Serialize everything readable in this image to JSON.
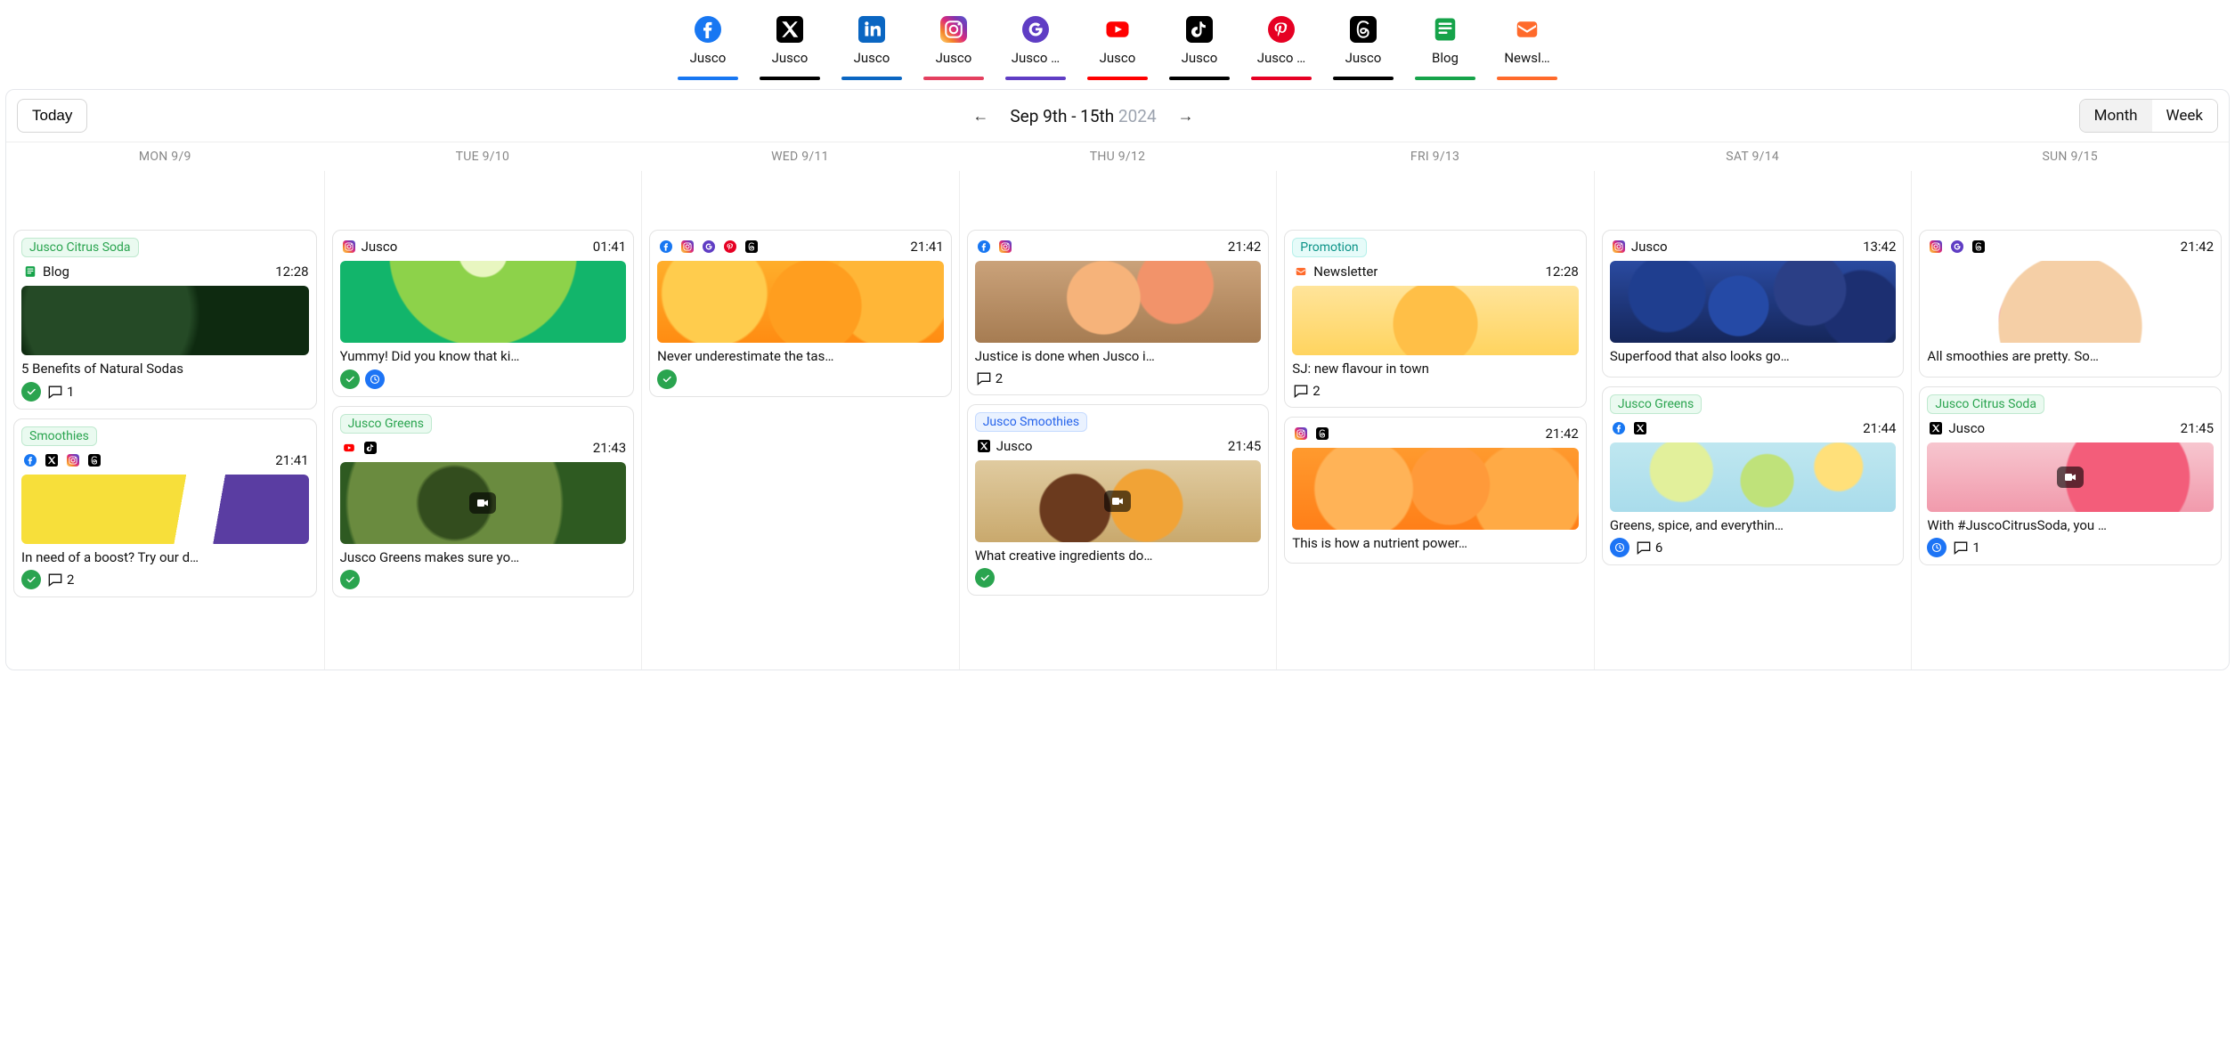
{
  "toolbar": {
    "today": "Today",
    "range_main": "Sep 9th - 15th",
    "range_year": "2024",
    "month": "Month",
    "week": "Week",
    "active_view": "Month"
  },
  "channels": [
    {
      "label": "Jusco",
      "color": "#1877F2",
      "platform": "facebook"
    },
    {
      "label": "Jusco",
      "color": "#000000",
      "platform": "x"
    },
    {
      "label": "Jusco",
      "color": "#0A66C2",
      "platform": "linkedin"
    },
    {
      "label": "Jusco",
      "color": "#E4405F",
      "platform": "instagram"
    },
    {
      "label": "Jusco …",
      "color": "#5f3dc4",
      "platform": "google"
    },
    {
      "label": "Jusco",
      "color": "#FF0000",
      "platform": "youtube"
    },
    {
      "label": "Jusco",
      "color": "#000000",
      "platform": "tiktok"
    },
    {
      "label": "Jusco …",
      "color": "#E60023",
      "platform": "pinterest"
    },
    {
      "label": "Jusco",
      "color": "#000000",
      "platform": "threads"
    },
    {
      "label": "Blog",
      "color": "#16a34a",
      "platform": "blog"
    },
    {
      "label": "Newsl…",
      "color": "#ff6a2b",
      "platform": "newsletter"
    }
  ],
  "days": [
    {
      "head": "MON 9/9"
    },
    {
      "head": "TUE 9/10"
    },
    {
      "head": "WED 9/11"
    },
    {
      "head": "THU 9/12"
    },
    {
      "head": "FRI 9/13"
    },
    {
      "head": "SAT 9/14"
    },
    {
      "head": "SUN 9/15"
    }
  ],
  "cards": {
    "mon1": {
      "tag": "Jusco Citrus Soda",
      "tag_style": "tag-green",
      "account": "Blog",
      "platforms": [
        "blog"
      ],
      "time": "12:28",
      "title": "5 Benefits of Natural Sodas",
      "thumb": "img-leaves",
      "status": [
        "approved"
      ],
      "comments": "1"
    },
    "mon2": {
      "tag": "Smoothies",
      "tag_style": "tag-green",
      "platforms": [
        "facebook",
        "x",
        "instagram",
        "threads"
      ],
      "time": "21:41",
      "title": "In need of a boost? Try our d…",
      "thumb": "img-yellow",
      "status": [
        "approved"
      ],
      "comments": "2"
    },
    "tue1": {
      "account": "Jusco",
      "platforms": [
        "instagram"
      ],
      "time": "01:41",
      "title": "Yummy! Did you know that ki…",
      "thumb": "img-kiwi",
      "thumb_tall": true,
      "status": [
        "approved",
        "scheduled"
      ]
    },
    "tue2": {
      "tag": "Jusco Greens",
      "tag_style": "tag-green",
      "platforms": [
        "youtube",
        "tiktok"
      ],
      "time": "21:43",
      "title": "Jusco Greens makes sure yo…",
      "thumb": "img-avocado",
      "thumb_tall": true,
      "video": true,
      "status": [
        "approved"
      ]
    },
    "wed1": {
      "platforms": [
        "facebook",
        "instagram",
        "google",
        "pinterest",
        "threads"
      ],
      "time": "21:41",
      "title": "Never underestimate the tas…",
      "thumb": "img-oranges",
      "thumb_tall": true,
      "status": [
        "approved"
      ]
    },
    "thu1": {
      "platforms": [
        "facebook",
        "instagram"
      ],
      "time": "21:42",
      "title": "Justice is done when Jusco i…",
      "thumb": "img-board",
      "thumb_tall": true,
      "comments": "2"
    },
    "thu2": {
      "tag": "Jusco Smoothies",
      "tag_style": "tag-blue",
      "account": "Jusco",
      "platforms": [
        "x"
      ],
      "time": "21:45",
      "title": "What creative ingredients do…",
      "thumb": "img-smoothie",
      "thumb_tall": true,
      "video": true,
      "status": [
        "approved"
      ]
    },
    "fri1": {
      "tag": "Promotion",
      "tag_style": "tag-teal",
      "account": "Newsletter",
      "platforms": [
        "newsletter"
      ],
      "time": "12:28",
      "title": "SJ: new flavour in town",
      "thumb": "img-juice",
      "comments": "2"
    },
    "fri2": {
      "platforms": [
        "instagram",
        "threads"
      ],
      "time": "21:42",
      "title": "This is how a nutrient power…",
      "thumb": "img-peach",
      "thumb_tall": true
    },
    "sat1": {
      "account": "Jusco",
      "platforms": [
        "instagram"
      ],
      "time": "13:42",
      "title": "Superfood that also looks go…",
      "thumb": "img-blue",
      "thumb_tall": true
    },
    "sat2": {
      "tag": "Jusco Greens",
      "tag_style": "tag-green",
      "platforms": [
        "facebook",
        "x"
      ],
      "time": "21:44",
      "title": "Greens, spice, and everythin…",
      "thumb": "img-limes",
      "status": [
        "scheduled"
      ],
      "comments": "6"
    },
    "sun1": {
      "platforms": [
        "instagram",
        "google",
        "threads"
      ],
      "time": "21:42",
      "title": "All smoothies are pretty. So…",
      "thumb": "img-bowl",
      "thumb_tall": true
    },
    "sun2": {
      "tag": "Jusco Citrus Soda",
      "tag_style": "tag-green",
      "account": "Jusco",
      "platforms": [
        "x"
      ],
      "time": "21:45",
      "title": "With #JuscoCitrusSoda, you …",
      "thumb": "img-pink",
      "video": true,
      "status": [
        "scheduled"
      ],
      "comments": "1"
    }
  },
  "columns": [
    [
      "mon1",
      "mon2"
    ],
    [
      "tue1",
      "tue2"
    ],
    [
      "wed1"
    ],
    [
      "thu1",
      "thu2"
    ],
    [
      "fri1",
      "fri2"
    ],
    [
      "sat1",
      "sat2"
    ],
    [
      "sun1",
      "sun2"
    ]
  ]
}
